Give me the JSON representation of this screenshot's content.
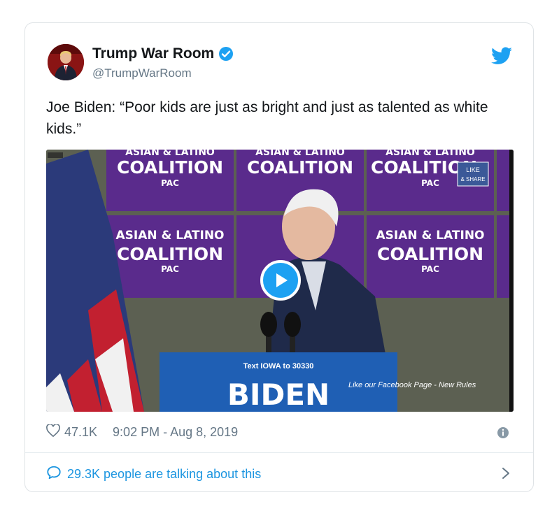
{
  "tweet": {
    "author_name": "Trump War Room",
    "handle": "@TrumpWarRoom",
    "text": "Joe Biden: “Poor kids are just as bright and just as talented as white kids.”",
    "likes": "47.1K",
    "timestamp": "9:02 PM - Aug 8, 2019",
    "talking_label": "29.3K people are talking about this"
  },
  "video": {
    "backdrop_line1": "ASIAN & LATINO",
    "backdrop_line2": "COALITION",
    "backdrop_line3": "PAC",
    "podium_top": "Text IOWA to 30330",
    "podium_main": "BIDEN",
    "overlay_caption": "Like our Facebook Page - New Rules",
    "badge_line1": "LIKE",
    "badge_line2": "& SHARE"
  },
  "icons": {
    "verified": "verified-badge-icon",
    "platform": "bird-logo-icon",
    "like": "heart-icon",
    "info": "info-icon",
    "reply": "speech-bubble-icon",
    "chevron": "chevron-right-icon",
    "play": "play-icon"
  },
  "colors": {
    "brand_blue": "#1da1f2",
    "link_blue": "#1b95e0",
    "muted_gray": "#657786",
    "backdrop_purple": "#5a2b8c"
  }
}
